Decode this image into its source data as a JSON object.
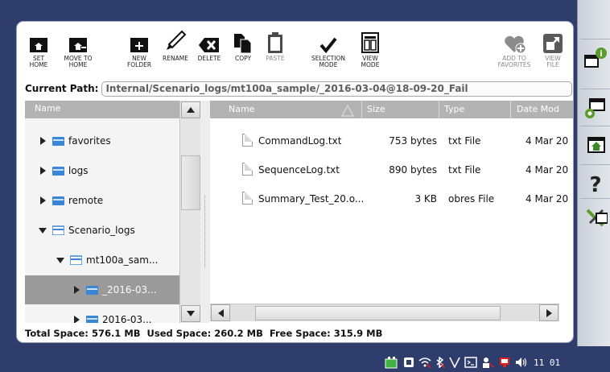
{
  "toolbar": {
    "buttons": [
      {
        "label": "SET\nHOME",
        "icon": "set-home-icon",
        "enabled": true
      },
      {
        "label": "MOVE TO\nHOME",
        "icon": "move-to-home-icon",
        "enabled": true
      },
      {
        "label": "NEW\nFOLDER",
        "icon": "new-folder-icon",
        "enabled": true
      },
      {
        "label": "RENAME",
        "icon": "rename-pencil-icon",
        "enabled": true
      },
      {
        "label": "DELETE",
        "icon": "delete-icon",
        "enabled": true
      },
      {
        "label": "COPY",
        "icon": "copy-icon",
        "enabled": true
      },
      {
        "label": "PASTE",
        "icon": "paste-clipboard-icon",
        "enabled": false
      },
      {
        "label": "SELECTION\nMODE",
        "icon": "checkmark-icon",
        "enabled": true
      },
      {
        "label": "VIEW\nMODE",
        "icon": "view-mode-icon",
        "enabled": true
      },
      {
        "label": "ADD TO\nFAVORITES",
        "icon": "add-favorite-heart-icon",
        "enabled": false
      },
      {
        "label": "VIEW\nFILE",
        "icon": "view-file-icon",
        "enabled": false
      }
    ]
  },
  "path": {
    "label": "Current Path:",
    "value": "Internal/Scenario_logs/mt100a_sample/_2016-03-04@18-09-20_Fail"
  },
  "tree": {
    "header": "Name",
    "items": [
      {
        "label": "favorites",
        "expanded": false,
        "selected": false
      },
      {
        "label": "logs",
        "expanded": false,
        "selected": false
      },
      {
        "label": "remote",
        "expanded": false,
        "selected": false
      },
      {
        "label": "Scenario_logs",
        "expanded": true,
        "selected": false
      },
      {
        "label": "mt100a_sam...",
        "expanded": true,
        "selected": false
      },
      {
        "label": "_2016-03...",
        "expanded": false,
        "selected": true
      },
      {
        "label": "2016-03...",
        "expanded": false,
        "selected": false
      }
    ]
  },
  "files": {
    "headers": {
      "name": "Name",
      "size": "Size",
      "type": "Type",
      "date": "Date Mod"
    },
    "rows": [
      {
        "name": "CommandLog.txt",
        "size": "753 bytes",
        "type": "txt File",
        "date": "4 Mar 20"
      },
      {
        "name": "SequenceLog.txt",
        "size": "890 bytes",
        "type": "txt File",
        "date": "4 Mar 20"
      },
      {
        "name": "Summary_Test_20.o...",
        "size": "3 KB",
        "type": "obres File",
        "date": "4 Mar 20"
      }
    ]
  },
  "space": {
    "total_label": "Total Space:",
    "total": "576.1 MB",
    "used_label": "Used Space:",
    "used": "260.2 MB",
    "free_label": "Free Space:",
    "free": "315.9 MB"
  },
  "side_panel": [
    "window-info-icon",
    "window-gear-icon",
    "window-home-icon",
    "help-question-icon",
    "tools-icon"
  ],
  "status": {
    "icons": [
      "battery-charging-icon",
      "network-icon",
      "wifi-icon",
      "bluetooth-icon",
      "v-icon",
      "terminal-icon",
      "person-icon",
      "screen-icon",
      "volume-icon"
    ],
    "clock": "11 01"
  },
  "colors": {
    "background": "#2e3d6b",
    "header_gray": "#b3b3b3",
    "folder_blue": "#3a86d6",
    "selected_row": "#9a9a9a"
  }
}
